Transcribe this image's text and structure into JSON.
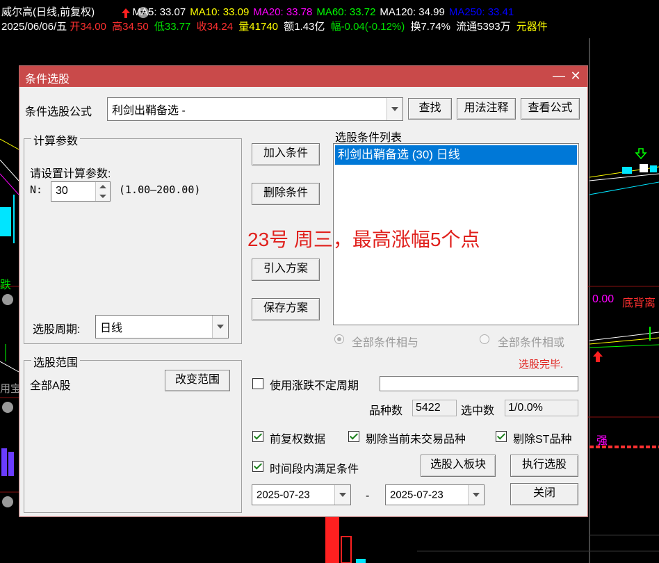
{
  "stock_header": {
    "name": "威尔高(日线,前复权)",
    "ma": [
      {
        "label": "MA5: 33.07",
        "color": "#ffffff"
      },
      {
        "label": "MA10: 33.09",
        "color": "#ffff00"
      },
      {
        "label": "MA20: 33.78",
        "color": "#ff00ff"
      },
      {
        "label": "MA60: 33.72",
        "color": "#00ff00"
      },
      {
        "label": "MA120: 34.99",
        "color": "#ffffff"
      },
      {
        "label": "MA250: 33.41",
        "color": "#0000ff"
      }
    ],
    "date": "2025/06/06/五",
    "open": "开34.00",
    "high": "高34.50",
    "low": "低33.77",
    "close": "收34.24",
    "volume": "量41740",
    "amount": "额1.43亿",
    "change": "幅-0.04(-0.12%)",
    "turnover": "换7.74%",
    "float": "流通5393万",
    "sector": "元器件"
  },
  "chart_side_text": {
    "left_fall": "跌",
    "left_use": "用宝",
    "right_val": "0.00",
    "right_label": "底背离",
    "right_strong": "强"
  },
  "dialog": {
    "title": "条件选股",
    "formula_label": "条件选股公式",
    "formula_value": "利剑出鞘备选  -",
    "find_button": "查找",
    "usage_button": "用法注释",
    "view_formula_button": "查看公式",
    "calc_params_group": "计算参数",
    "set_params_prompt": "请设置计算参数:",
    "param_n_label": "N:",
    "param_n_value": "30",
    "param_n_range": "(1.00—200.00)",
    "period_label": "选股周期:",
    "period_value": "日线",
    "scope_group": "选股范围",
    "scope_value": "全部A股",
    "change_scope_button": "改变范围",
    "add_condition_button": "加入条件",
    "delete_condition_button": "删除条件",
    "import_plan_button": "引入方案",
    "save_plan_button": "保存方案",
    "condition_list_label": "选股条件列表",
    "condition_items": [
      "利剑出鞘备选 (30) 日线"
    ],
    "annotation": "23号 周三，最高涨幅5个点",
    "annotation_color": "#e0201c",
    "radio_and": "全部条件相与",
    "radio_or": "全部条件相或",
    "status": "选股完毕.",
    "status_color": "#e0201c",
    "use_variable_period_label": "使用涨跌不定周期",
    "variable_period_value": "",
    "total_count_label": "品种数",
    "total_count_value": "5422",
    "selected_count_label": "选中数",
    "selected_count_value": "1/0.0%",
    "adj_data_label": "前复权数据",
    "adj_data_checked": true,
    "exclude_untraded_label": "剔除当前未交易品种",
    "exclude_untraded_checked": true,
    "exclude_st_label": "剔除ST品种",
    "exclude_st_checked": true,
    "time_range_label": "时间段内满足条件",
    "time_range_checked": true,
    "to_block_button": "选股入板块",
    "execute_button": "执行选股",
    "date_from": "2025-07-23",
    "date_sep": "-",
    "date_to": "2025-07-23",
    "close_button": "关闭"
  }
}
